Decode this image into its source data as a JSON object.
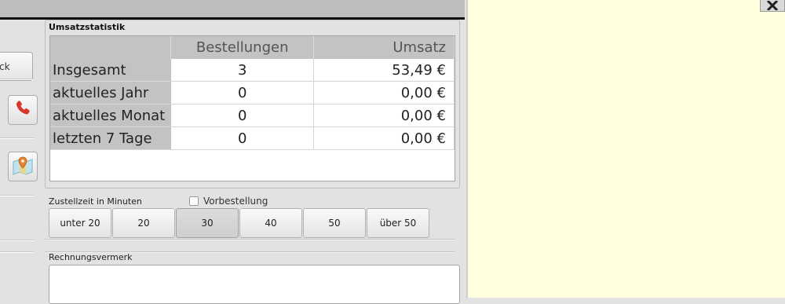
{
  "left_strip": {
    "partial_button_label": "ck"
  },
  "stats": {
    "title": "Umsatzstatistik",
    "columns": [
      "",
      "Bestellungen",
      "Umsatz"
    ],
    "rows": [
      {
        "label": "Insgesamt",
        "orders": "3",
        "revenue": "53,49 €"
      },
      {
        "label": "aktuelles Jahr",
        "orders": "0",
        "revenue": "0,00 €"
      },
      {
        "label": "aktuelles Monat",
        "orders": "0",
        "revenue": "0,00 €"
      },
      {
        "label": "letzten 7 Tage",
        "orders": "0",
        "revenue": "0,00 €"
      }
    ]
  },
  "delivery": {
    "label": "Zustellzeit in Minuten",
    "preorder_label": "Vorbestellung",
    "options": [
      "unter 20",
      "20",
      "30",
      "40",
      "50",
      "über 50"
    ],
    "selected": "30"
  },
  "invoice_note": {
    "label": "Rechnungsvermerk",
    "value": ""
  },
  "icons": {
    "phone": "phone-icon",
    "map": "map-pin-icon",
    "close": "close-icon"
  },
  "colors": {
    "phone_red": "#d9362b",
    "panel_bg": "#ffffdd"
  }
}
